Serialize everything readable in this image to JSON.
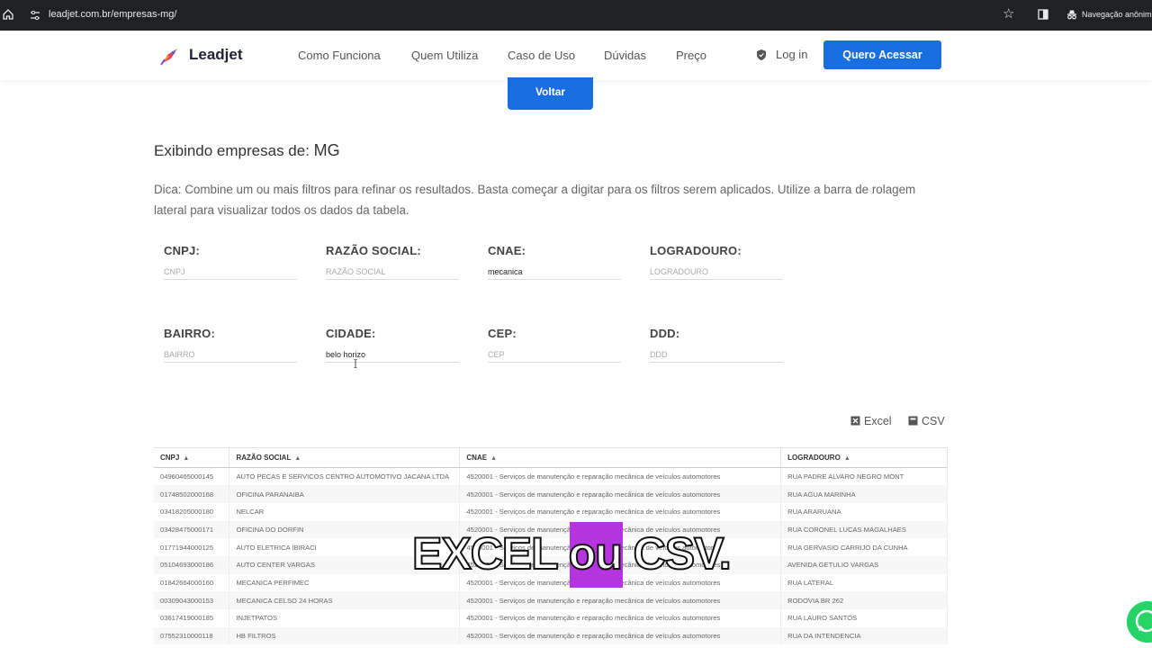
{
  "browser": {
    "url": "leadjet.com.br/empresas-mg/",
    "incognito_label": "Navegação anônima"
  },
  "header": {
    "logo_text": "Leadjet",
    "nav": [
      "Como Funciona",
      "Quem Utiliza",
      "Caso de Uso",
      "Dúvidas",
      "Preço"
    ],
    "login_label": "Log in",
    "cta_label": "Quero Acessar"
  },
  "back_button": "Voltar",
  "title": {
    "prefix": "Exibindo empresas de: ",
    "state": "MG"
  },
  "tip": "Dica: Combine um ou mais filtros para refinar os resultados. Basta começar a digitar para os filtros serem aplicados. Utilize a barra de rolagem lateral para visualizar todos os dados da tabela.",
  "filters": {
    "cnpj": {
      "label": "CNPJ:",
      "placeholder": "CNPJ",
      "value": ""
    },
    "razao": {
      "label": "RAZÃO SOCIAL:",
      "placeholder": "RAZÃO SOCIAL",
      "value": ""
    },
    "cnae": {
      "label": "CNAE:",
      "placeholder": "CNAE",
      "value": "mecanica"
    },
    "logradouro": {
      "label": "LOGRADOURO:",
      "placeholder": "LOGRADOURO",
      "value": ""
    },
    "bairro": {
      "label": "BAIRRO:",
      "placeholder": "BAIRRO",
      "value": ""
    },
    "cidade": {
      "label": "CIDADE:",
      "placeholder": "CIDADE",
      "value": "belo horizo"
    },
    "cep": {
      "label": "CEP:",
      "placeholder": "CEP",
      "value": ""
    },
    "ddd": {
      "label": "DDD:",
      "placeholder": "DDD",
      "value": ""
    }
  },
  "export": {
    "excel": "Excel",
    "csv": "CSV"
  },
  "table": {
    "columns": [
      "CNPJ",
      "RAZÃO SOCIAL",
      "CNAE",
      "LOGRADOURO"
    ],
    "rows": [
      [
        "04960465000145",
        "AUTO PECAS E SERVICOS CENTRO AUTOMOTIVO JACANA LTDA",
        "4520001 - Serviços de manutenção e reparação mecânica de veículos automotores",
        "RUA PADRE ALVARO NEGRO MONT"
      ],
      [
        "01748502000168",
        "OFICINA PARANAIBA",
        "4520001 - Serviços de manutenção e reparação mecânica de veículos automotores",
        "RUA AGUA MARINHA"
      ],
      [
        "03418205000180",
        "NELCAR",
        "4520001 - Serviços de manutenção e reparação mecânica de veículos automotores",
        "RUA ARARUANA"
      ],
      [
        "03428475000171",
        "OFICINA DO DORFIN",
        "4520001 - Serviços de manutenção e reparação mecânica de veículos automotores",
        "RUA CORONEL LUCAS MAGALHAES"
      ],
      [
        "01771944000125",
        "AUTO ELETRICA IBIRACI",
        "4520001 - Serviços de manutenção e reparação mecânica de veículos automotores",
        "RUA GERVASIO CARRIJO DA CUNHA"
      ],
      [
        "05104693000186",
        "AUTO CENTER VARGAS",
        "4520001 - Serviços de manutenção e reparação mecânica de veículos automotores",
        "AVENIDA GETULIO VARGAS"
      ],
      [
        "01842664000160",
        "MECANICA PERFIMEC",
        "4520001 - Serviços de manutenção e reparação mecânica de veículos automotores",
        "RUA LATERAL"
      ],
      [
        "00309043000153",
        "MECANICA CELSO 24 HORAS",
        "4520001 - Serviços de manutenção e reparação mecânica de veículos automotores",
        "RODOVIA BR 262"
      ],
      [
        "03617419000185",
        "INJETPATOS",
        "4520001 - Serviços de manutenção e reparação mecânica de veículos automotores",
        "RUA LAURO SANTOS"
      ],
      [
        "07552310000118",
        "HB FILTROS",
        "4520001 - Serviços de manutenção e reparação mecânica de veículos automotores",
        "RUA DA INTENDENCIA"
      ]
    ]
  },
  "overlay_caption": "EXCEL ou CSV.",
  "colors": {
    "primary": "#1a6fe0",
    "caption_highlight": "#b633e0",
    "whatsapp": "#25d366"
  }
}
